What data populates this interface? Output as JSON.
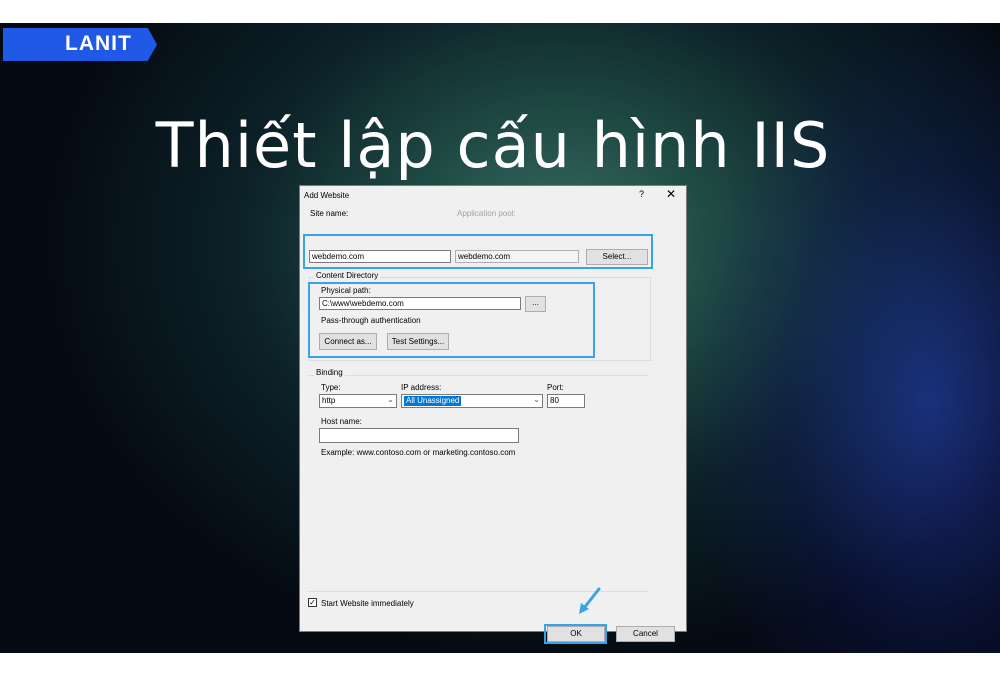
{
  "brand": {
    "logo_text": "LANIT",
    "accent": "#1f59e6"
  },
  "slide": {
    "title": "Thiết lập cấu hình IIS"
  },
  "dialog": {
    "title": "Add Website",
    "help": "?",
    "close": "✕",
    "site_name": {
      "label": "Site name:",
      "value": "webdemo.com"
    },
    "app_pool": {
      "label": "Application pool:",
      "value": "webdemo.com",
      "select_button": "Select..."
    },
    "content_directory": {
      "group_label": "Content Directory",
      "physical_path_label": "Physical path:",
      "physical_path_value": "C:\\www\\webdemo.com",
      "browse_button": "...",
      "pass_through_label": "Pass-through authentication",
      "connect_as_button": "Connect as...",
      "test_settings_button": "Test Settings..."
    },
    "binding": {
      "group_label": "Binding",
      "type_label": "Type:",
      "type_value": "http",
      "ip_label": "IP address:",
      "ip_value": "All Unassigned",
      "port_label": "Port:",
      "port_value": "80",
      "host_label": "Host name:",
      "host_value": "",
      "example": "Example: www.contoso.com or marketing.contoso.com"
    },
    "start_immediately": {
      "label": "Start Website immediately",
      "checked": true
    },
    "ok_button": "OK",
    "cancel_button": "Cancel",
    "highlight_color": "#3aa3e3"
  }
}
